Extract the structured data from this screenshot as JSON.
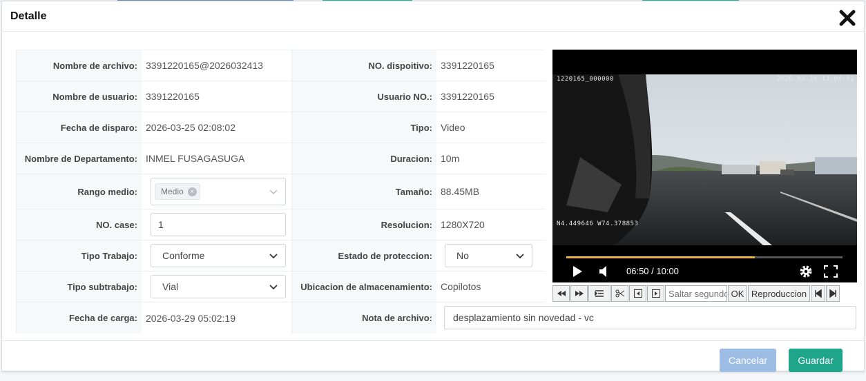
{
  "modal": {
    "title": "Detalle"
  },
  "fields": {
    "nombre_archivo": {
      "label": "Nombre de archivo:",
      "value": "3391220165@2026032413"
    },
    "no_dispositivo": {
      "label": "NO. dispoitivo:",
      "value": "3391220165"
    },
    "nombre_usuario": {
      "label": "Nombre de usuario:",
      "value": "3391220165"
    },
    "usuario_no": {
      "label": "Usuario NO.:",
      "value": "3391220165"
    },
    "fecha_disparo": {
      "label": "Fecha de disparo:",
      "value": "2026-03-25 02:08:02"
    },
    "tipo": {
      "label": "Tipo:",
      "value": "Video"
    },
    "departamento": {
      "label": "Nombre de Departamento:",
      "value": "INMEL FUSAGASUGA"
    },
    "duracion": {
      "label": "Duracion:",
      "value": "10m"
    },
    "rango_medio": {
      "label": "Rango medio:",
      "tag": "Medio"
    },
    "tamano": {
      "label": "Tamaño:",
      "value": "88.45MB"
    },
    "no_case": {
      "label": "NO. case:",
      "value": "1"
    },
    "resolucion": {
      "label": "Resolucion:",
      "value": "1280X720"
    },
    "tipo_trabajo": {
      "label": "Tipo Trabajo:",
      "value": "Conforme"
    },
    "estado_proteccion": {
      "label": "Estado de proteccion:",
      "value": "No"
    },
    "tipo_subtrabajo": {
      "label": "Tipo subtrabajo:",
      "value": "Vial"
    },
    "ubicacion": {
      "label": "Ubicacion de almacenamiento:",
      "value": "Copilotos"
    },
    "fecha_carga": {
      "label": "Fecha de carga:",
      "value": "2026-03-29 05:02:19"
    },
    "nota_archivo": {
      "label": "Nota de archivo:",
      "value": "desplazamiento sin novedad - vc"
    }
  },
  "video": {
    "osd_top_left": "1220165_000000",
    "osd_top_right": "2026-03-24  13:04:51",
    "osd_coords": "N4.449646  W74.378853",
    "time_display": "06:50 / 10:00",
    "progress": 0.683,
    "accent_color": "#e8b24a"
  },
  "toolbar": {
    "seek_placeholder": "Saltar segundo",
    "ok_label": "OK",
    "playback_label": "Reproduccion"
  },
  "footer": {
    "cancel_label": "Cancelar",
    "save_label": "Guardar",
    "cancel_color": "#9ebde4",
    "save_color": "#1fa58a"
  }
}
